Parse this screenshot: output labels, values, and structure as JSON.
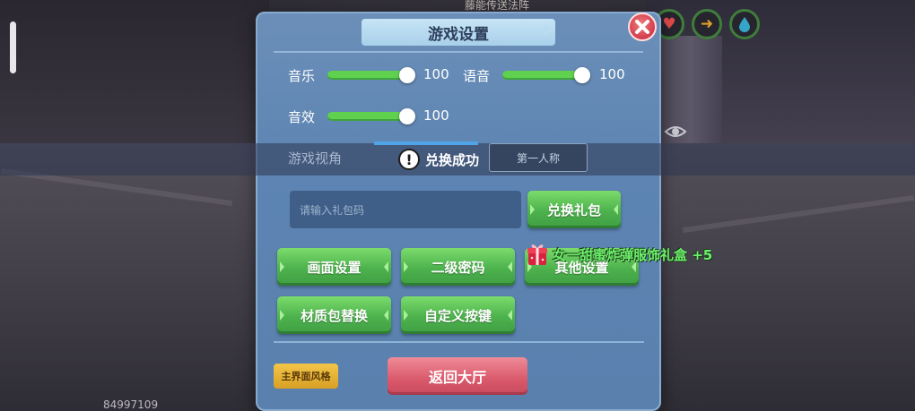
{
  "background": {
    "title": "藤能传送法阵",
    "player_id": "84997109"
  },
  "status_icons": [
    {
      "name": "heart-icon",
      "glyph": "♥",
      "color": "#e04b4b"
    },
    {
      "name": "arrow-icon",
      "glyph": "➜",
      "color": "#e0a02a"
    },
    {
      "name": "drop-icon",
      "glyph": "💧",
      "color": "#35a6c8"
    }
  ],
  "panel": {
    "title": "游戏设置",
    "sliders": [
      {
        "label": "音乐",
        "value": "100",
        "level": 1.0
      },
      {
        "label": "语音",
        "value": "100",
        "level": 1.0
      },
      {
        "label": "音效",
        "value": "100",
        "level": 1.0
      }
    ],
    "view": {
      "label": "游戏视角",
      "option": "第一人称"
    },
    "toast": "兑换成功",
    "gift": {
      "placeholder": "请输入礼包码",
      "redeem": "兑换礼包"
    },
    "buttons": {
      "graphics": "画面设置",
      "second_password": "二级密码",
      "other": "其他设置",
      "texture_pack": "材质包替换",
      "custom_keys": "自定义按键"
    },
    "style_button": "主界面风格",
    "lobby_button": "返回大厅"
  },
  "reward": {
    "text": "女一甜蜜炸弹服饰礼盒 +5"
  },
  "colors": {
    "panel": "#5d84b2",
    "green": "#4db24d",
    "lobby": "#d9596b",
    "reward_text": "#6df06b"
  }
}
